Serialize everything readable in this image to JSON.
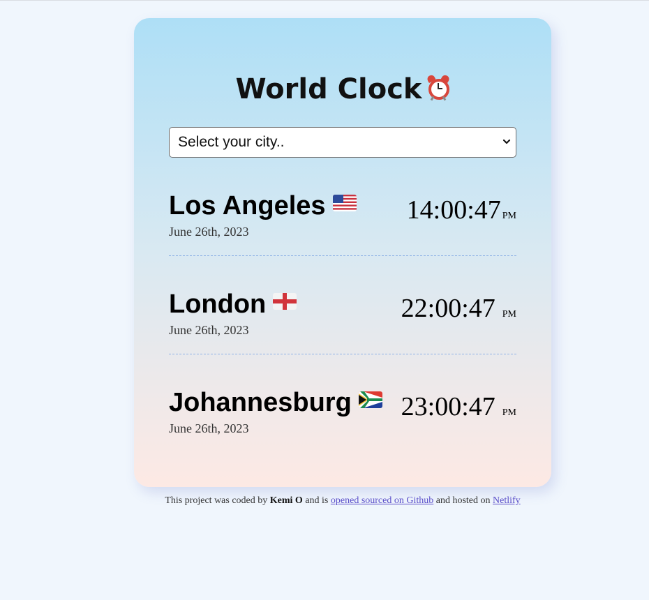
{
  "app": {
    "title": "World Clock",
    "title_icon": "alarm-clock-icon"
  },
  "city_select": {
    "selected": "Select your city..",
    "icon": "chevron-down-icon"
  },
  "cities": [
    {
      "name": "Los Angeles",
      "flag": "flag-us-icon",
      "date": "June 26th, 2023",
      "time": "14:00:47",
      "ampm": "PM"
    },
    {
      "name": "London",
      "flag": "flag-england-icon",
      "date": "June 26th, 2023",
      "time": "22:00:47",
      "ampm": "PM"
    },
    {
      "name": "Johannesburg",
      "flag": "flag-south-africa-icon",
      "date": "June 26th, 2023",
      "time": "23:00:47",
      "ampm": "PM"
    }
  ],
  "footer": {
    "text_before": "This project was coded by ",
    "author": "Kemi O",
    "text_middle": " and is ",
    "github_link": "opened sourced on Github",
    "text_after": " and hosted on ",
    "netlify_link": "Netlify"
  },
  "colors": {
    "page_bg": "#f0f6fd",
    "card_top": "#aedff6",
    "card_bottom": "#fde9e4",
    "divider": "#8fb2e6",
    "link": "#5a4ec9"
  }
}
